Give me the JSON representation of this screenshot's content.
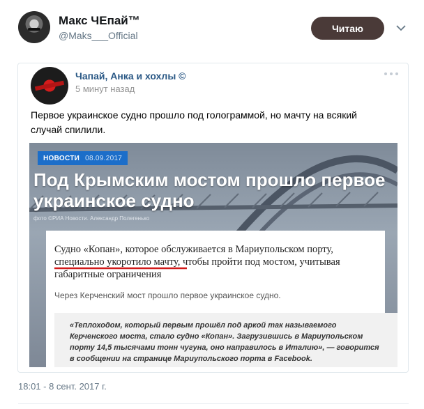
{
  "author": {
    "name": "Макс ЧЕпай™",
    "handle": "@Maks___Official",
    "avatar_icon": "user-avatar"
  },
  "follow_button": {
    "label": "Читаю",
    "color": "#4a3a38"
  },
  "menu_icon": "chevron-down-icon",
  "embedded_post": {
    "group_name": "Чапай, Анка и хохлы ©",
    "time": "5 минут назад",
    "text": "Первое украинское судно прошло под голограммой, но мачту на всякий случай спилили.",
    "more_icon": "more-dots-icon",
    "image": {
      "badge": "НОВОСТИ",
      "badge_date": "08.09.2017",
      "headline": "Под Крымским мостом прошло первое украинское судно",
      "credit": "фото ©РИА Новости. Александр Полегенько",
      "lead": "Судно «Копан», которое обслуживается в Мариупольском порту, специально укоротило мачту, чтобы пройти под мостом, учитывая габаритные ограничения",
      "sub": "Через Керченский мост прошло первое украинское судно.",
      "quote": "«Теплоходом, который первым прошёл под аркой так называемого Керченского моста, стало судно «Копан». Загрузившись в Мариупольском порту 14,5 тысячами тонн чугуна, оно направилось в Италию», — говорится в сообщении на странице Мариупольского порта в Facebook."
    }
  },
  "timestamp": "18:01 - 8 сент. 2017 г."
}
